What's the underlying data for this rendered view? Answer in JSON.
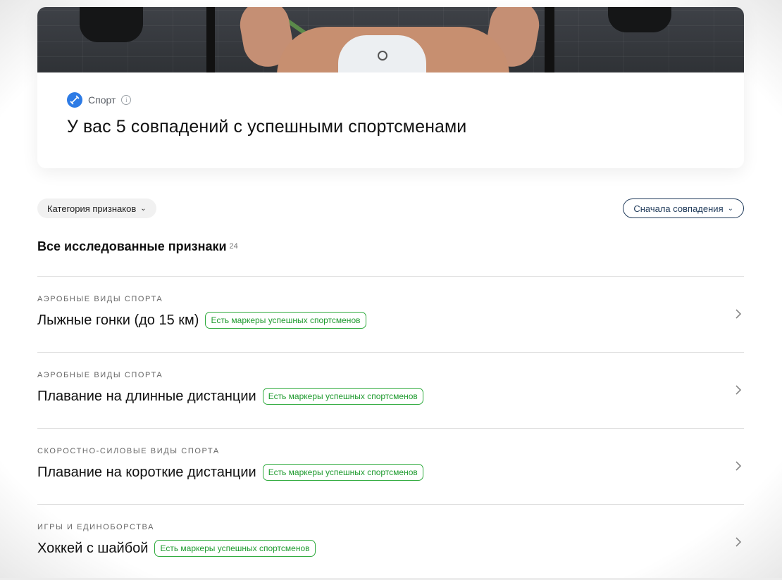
{
  "hero": {
    "category": "Спорт",
    "info_icon": "info-icon",
    "title": "У вас 5 совпадений с успешными спортсменами"
  },
  "filters": {
    "category_label": "Категория признаков",
    "sort_label": "Сначала совпадения"
  },
  "section": {
    "title": "Все исследованные признаки",
    "count": "24"
  },
  "items": [
    {
      "category": "АЭРОБНЫЕ ВИДЫ СПОРТА",
      "title": "Лыжные гонки (до 15 км)",
      "badge": "Есть маркеры успешных спортсменов"
    },
    {
      "category": "АЭРОБНЫЕ ВИДЫ СПОРТА",
      "title": "Плавание на длинные дистанции",
      "badge": "Есть маркеры успешных спортсменов"
    },
    {
      "category": "СКОРОСТНО-СИЛОВЫЕ ВИДЫ СПОРТА",
      "title": "Плавание на короткие дистанции",
      "badge": "Есть маркеры успешных спортсменов"
    },
    {
      "category": "ИГРЫ И ЕДИНОБОРСТВА",
      "title": "Хоккей с шайбой",
      "badge": "Есть маркеры успешных спортсменов"
    }
  ],
  "colors": {
    "accent_blue": "#2d7be5",
    "badge_green": "#1e9a2e",
    "sort_border": "#1f3a5a"
  }
}
